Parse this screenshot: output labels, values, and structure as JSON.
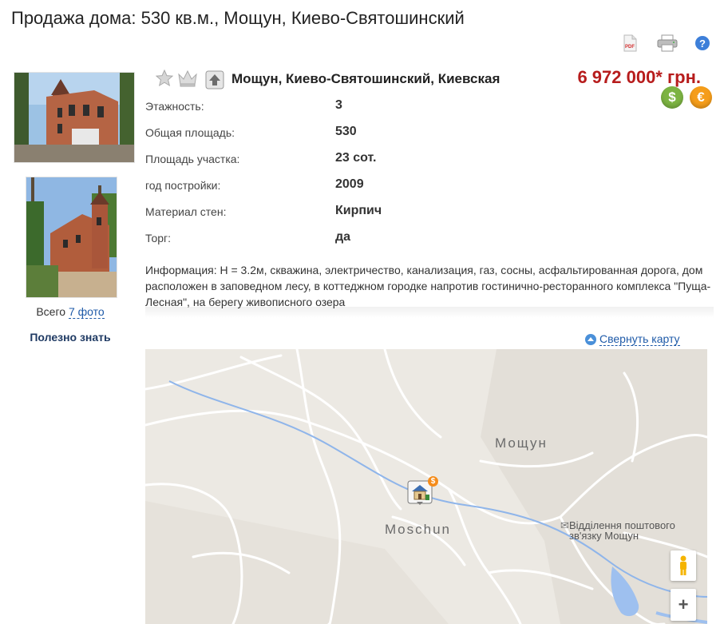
{
  "page": {
    "title": "Продажа дома: 530 кв.м., Мощун, Киево-Святошинский"
  },
  "toolbar": {
    "pdf_label": "PDF"
  },
  "photos": {
    "count_prefix": "Всего ",
    "count_link": "7 фото",
    "useful": "Полезно знать"
  },
  "listing": {
    "location": "Мощун, Киево-Святошинский, Киевская",
    "price": "6 972 000* грн.",
    "currency_usd": "$",
    "currency_eur": "€",
    "properties": [
      {
        "label": "Этажность:",
        "value": "3"
      },
      {
        "label": "Общая площадь:",
        "value": "530"
      },
      {
        "label": "Площадь участка:",
        "value": "23 сот."
      },
      {
        "label": "год постройки:",
        "value": "2009"
      },
      {
        "label": "Материал стен:",
        "value": "Кирпич"
      },
      {
        "label": "Торг:",
        "value": "да"
      }
    ],
    "info": "Информация: H = 3.2м, скважина, электричество, канализация, газ, сосны, асфальтированная дорога, дом расположен в заповедном лесу, в коттеджном городке напротив гостинично-ресторанного комплекса \"Пуща-Лесная\", на берегу живописного озера"
  },
  "map": {
    "collapse_label": "Свернуть карту",
    "label_village_cyr": "Мощун",
    "label_village_lat": "Moschun",
    "label_post_office": "Відділення поштового зв'язку Мощун",
    "post_line1": "Відділення поштового",
    "post_line2": "зв'язку Мощун",
    "zoom_in": "+",
    "marker_badge": "$"
  },
  "colors": {
    "price": "#b71c1c",
    "link": "#1e5aa8",
    "usd": "#7cb342",
    "eur": "#f59d1a",
    "water": "#9ec0ef"
  }
}
